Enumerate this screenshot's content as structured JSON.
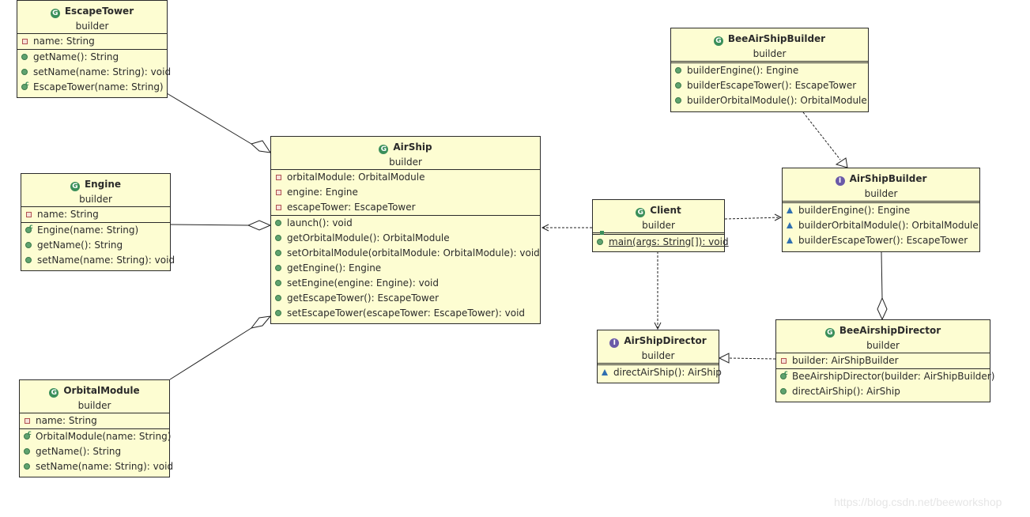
{
  "classes": {
    "escapeTower": {
      "name": "EscapeTower",
      "package": "builder",
      "kind": "class",
      "fields": [
        {
          "vis": "private",
          "text": "name: String"
        }
      ],
      "methods": [
        {
          "vis": "public",
          "text": "getName(): String"
        },
        {
          "vis": "public",
          "text": "setName(name: String): void"
        },
        {
          "vis": "constructor",
          "text": "EscapeTower(name: String)"
        }
      ]
    },
    "engine": {
      "name": "Engine",
      "package": "builder",
      "kind": "class",
      "fields": [
        {
          "vis": "private",
          "text": "name: String"
        }
      ],
      "methods": [
        {
          "vis": "constructor",
          "text": "Engine(name: String)"
        },
        {
          "vis": "public",
          "text": "getName(): String"
        },
        {
          "vis": "public",
          "text": "setName(name: String): void"
        }
      ]
    },
    "orbitalModule": {
      "name": "OrbitalModule",
      "package": "builder",
      "kind": "class",
      "fields": [
        {
          "vis": "private",
          "text": "name: String"
        }
      ],
      "methods": [
        {
          "vis": "constructor",
          "text": "OrbitalModule(name: String)"
        },
        {
          "vis": "public",
          "text": "getName(): String"
        },
        {
          "vis": "public",
          "text": "setName(name: String): void"
        }
      ]
    },
    "airShip": {
      "name": "AirShip",
      "package": "builder",
      "kind": "class",
      "fields": [
        {
          "vis": "private",
          "text": "orbitalModule: OrbitalModule"
        },
        {
          "vis": "private",
          "text": "engine: Engine"
        },
        {
          "vis": "private",
          "text": "escapeTower: EscapeTower"
        }
      ],
      "methods": [
        {
          "vis": "public",
          "text": "launch(): void"
        },
        {
          "vis": "public",
          "text": "getOrbitalModule(): OrbitalModule"
        },
        {
          "vis": "public",
          "text": "setOrbitalModule(orbitalModule: OrbitalModule): void"
        },
        {
          "vis": "public",
          "text": "getEngine(): Engine"
        },
        {
          "vis": "public",
          "text": "setEngine(engine: Engine): void"
        },
        {
          "vis": "public",
          "text": "getEscapeTower(): EscapeTower"
        },
        {
          "vis": "public",
          "text": "setEscapeTower(escapeTower: EscapeTower): void"
        }
      ]
    },
    "client": {
      "name": "Client",
      "package": "builder",
      "kind": "class",
      "fields": [],
      "methods": [
        {
          "vis": "static",
          "text": "main(args: String[]): void"
        }
      ]
    },
    "beeAirShipBuilder": {
      "name": "BeeAirShipBuilder",
      "package": "builder",
      "kind": "class",
      "fields": [],
      "methods": [
        {
          "vis": "public",
          "text": "builderEngine(): Engine"
        },
        {
          "vis": "public",
          "text": "builderEscapeTower(): EscapeTower"
        },
        {
          "vis": "public",
          "text": "builderOrbitalModule(): OrbitalModule"
        }
      ]
    },
    "airShipBuilder": {
      "name": "AirShipBuilder",
      "package": "builder",
      "kind": "interface",
      "fields": [],
      "methods": [
        {
          "vis": "abstract",
          "text": "builderEngine(): Engine"
        },
        {
          "vis": "abstract",
          "text": "builderOrbitalModule(): OrbitalModule"
        },
        {
          "vis": "abstract",
          "text": "builderEscapeTower(): EscapeTower"
        }
      ]
    },
    "airShipDirector": {
      "name": "AirShipDirector",
      "package": "builder",
      "kind": "interface",
      "fields": [],
      "methods": [
        {
          "vis": "abstract",
          "text": "directAirShip(): AirShip"
        }
      ]
    },
    "beeAirshipDirector": {
      "name": "BeeAirshipDirector",
      "package": "builder",
      "kind": "class",
      "fields": [
        {
          "vis": "private",
          "text": "builder: AirShipBuilder"
        }
      ],
      "methods": [
        {
          "vis": "constructor",
          "text": "BeeAirshipDirector(builder: AirShipBuilder)"
        },
        {
          "vis": "public",
          "text": "directAirShip(): AirShip"
        }
      ]
    }
  },
  "relations": [
    {
      "from": "EscapeTower",
      "to": "AirShip",
      "type": "aggregation"
    },
    {
      "from": "Engine",
      "to": "AirShip",
      "type": "aggregation"
    },
    {
      "from": "OrbitalModule",
      "to": "AirShip",
      "type": "aggregation"
    },
    {
      "from": "Client",
      "to": "AirShip",
      "type": "dependency"
    },
    {
      "from": "Client",
      "to": "AirShipBuilder",
      "type": "dependency"
    },
    {
      "from": "Client",
      "to": "AirShipDirector",
      "type": "dependency"
    },
    {
      "from": "BeeAirShipBuilder",
      "to": "AirShipBuilder",
      "type": "realization"
    },
    {
      "from": "BeeAirshipDirector",
      "to": "AirShipDirector",
      "type": "realization"
    },
    {
      "from": "AirShipBuilder",
      "to": "BeeAirshipDirector",
      "type": "aggregation"
    }
  ],
  "icons": {
    "class": "G",
    "interface": "I"
  },
  "watermark": "https://blog.csdn.net/beeworkshop"
}
